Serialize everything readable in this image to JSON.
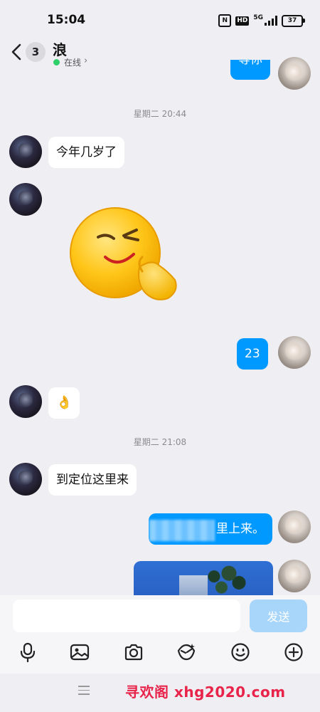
{
  "status_bar": {
    "time": "15:04",
    "nfc": "N",
    "hd": "HD",
    "network": "5G",
    "battery": "37"
  },
  "header": {
    "unread_count": "3",
    "contact_name": "浪",
    "status_text": "在线",
    "status_chevron": "›"
  },
  "messages": {
    "top_partial": "等你",
    "time_1": "星期二 20:44",
    "msg_1": "今年几岁了",
    "sticker_icon": "smirk-face-sticker",
    "msg_reply_age": "23",
    "msg_ok_emoji": "👌",
    "time_2": "星期二 21:08",
    "msg_2": "到定位这里来",
    "msg_reply_partial": "里上来。"
  },
  "input": {
    "placeholder": "",
    "send_label": "发送"
  },
  "toolbar": {
    "icons": [
      "microphone-icon",
      "image-icon",
      "camera-icon",
      "red-packet-icon",
      "emoji-icon",
      "plus-icon"
    ]
  },
  "nav": {
    "watermark": "寻欢阁 xhg2020.com"
  },
  "colors": {
    "accent_blue": "#0099ff",
    "send_disabled": "#a8d6fb",
    "online_green": "#2fd06a",
    "watermark_red": "#e8244a"
  }
}
